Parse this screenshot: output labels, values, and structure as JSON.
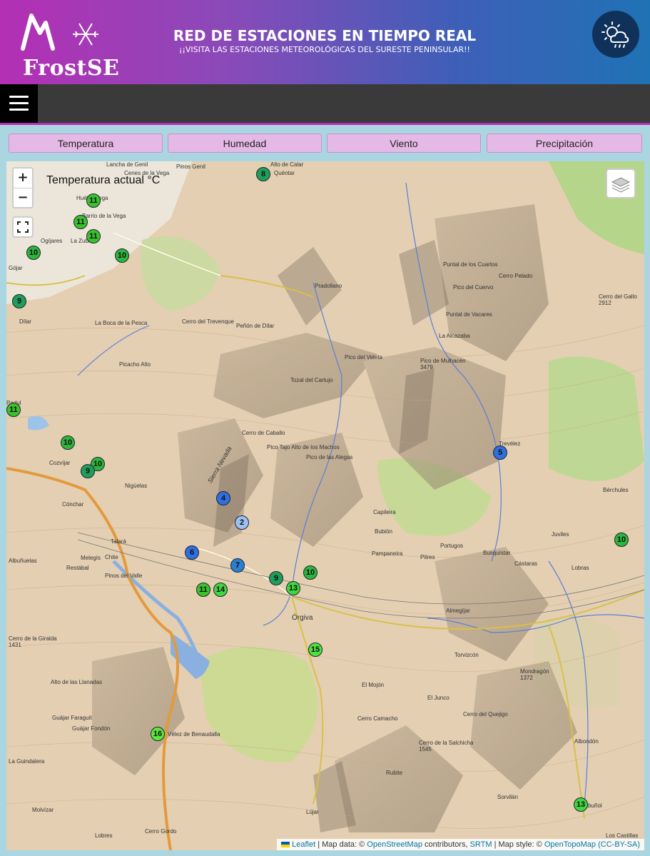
{
  "header": {
    "logo_text": "FrostSE",
    "title": "RED DE ESTACIONES EN TIEMPO REAL",
    "subtitle": "¡¡VISITA LAS ESTACIONES METEOROLÓGICAS DEL SURESTE PENINSULAR!!",
    "weather_icon": "weather-icon"
  },
  "tabs": [
    {
      "label": "Temperatura"
    },
    {
      "label": "Humedad"
    },
    {
      "label": "Viento"
    },
    {
      "label": "Precipitación"
    }
  ],
  "map": {
    "layer_label": "Temperatura actual °C",
    "zoom_in": "+",
    "zoom_out": "−",
    "attribution": {
      "leaflet": "Leaflet",
      "sep1": " | Map data: © ",
      "osm": "OpenStreetMap",
      "contrib": " contributors, ",
      "srtm": "SRTM",
      "style": " | Map style: © ",
      "otm": "OpenTopoMap",
      "license": "(CC-BY-SA)"
    },
    "markers": [
      {
        "value": "8",
        "color": "#1f9e5a"
      },
      {
        "value": "11",
        "color": "#39c22c"
      },
      {
        "value": "11",
        "color": "#39c22c"
      },
      {
        "value": "11",
        "color": "#39c22c"
      },
      {
        "value": "10",
        "color": "#2db53c"
      },
      {
        "value": "10",
        "color": "#2db53c"
      },
      {
        "value": "9",
        "color": "#1f9e5a"
      },
      {
        "value": "11",
        "color": "#39c22c"
      },
      {
        "value": "10",
        "color": "#2db53c"
      },
      {
        "value": "10",
        "color": "#2db53c"
      },
      {
        "value": "9",
        "color": "#1f9e5a"
      },
      {
        "value": "5",
        "color": "#2f6fe0"
      },
      {
        "value": "4",
        "color": "#2f6fe0"
      },
      {
        "value": "2",
        "color": "#9dc0f0"
      },
      {
        "value": "6",
        "color": "#2f6fe0"
      },
      {
        "value": "7",
        "color": "#2a7fd0"
      },
      {
        "value": "9",
        "color": "#1f9e5a"
      },
      {
        "value": "10",
        "color": "#2db53c"
      },
      {
        "value": "13",
        "color": "#3fd63f"
      },
      {
        "value": "11",
        "color": "#39c22c"
      },
      {
        "value": "14",
        "color": "#3fd63f"
      },
      {
        "value": "10",
        "color": "#2db53c"
      },
      {
        "value": "15",
        "color": "#4fe040"
      },
      {
        "value": "16",
        "color": "#5ae83c"
      },
      {
        "value": "13",
        "color": "#3fd63f"
      }
    ],
    "places": [
      "Pinos Genil",
      "Huétor Vega",
      "Barrio de la Vega",
      "Ogíjares",
      "La Zubia",
      "Gójar",
      "Dílar",
      "Pradollano",
      "Peñón de Dílar",
      "Cerro del Trevenque",
      "La Boca de la Pesca",
      "Picacho Alto",
      "Pico del Veleta",
      "Pico de Mulhacén 3479",
      "Tozal del Cartujo",
      "Cerro de Caballo",
      "Pico Tajo Alto de los Machos",
      "Pico de las Alegas",
      "Trevélez",
      "Capileira",
      "Bubión",
      "Pampaneira",
      "Pitres",
      "Portugos",
      "Busquístar",
      "Cástaras",
      "Lobras",
      "Bérchules",
      "Juviles",
      "Órgiva",
      "Almegíjar",
      "Torvizcón",
      "El Mojón",
      "El Junco",
      "Cerro del Quejigo",
      "Cerro de la Salchicha 1545",
      "Cerro Camacho",
      "Mondragón 1372",
      "Albondón",
      "Rubite",
      "Sorvilán",
      "Albuñol",
      "Los Castillas",
      "Lújar",
      "Cerro Gordo",
      "Lobres",
      "Molvízar",
      "Vélez de Benaudalla",
      "Guájar Faraguit",
      "Guájar Fondón",
      "Alto de las Llanadas",
      "Pinos del Valle",
      "Restábal",
      "Melegís",
      "Chite",
      "Talará",
      "Nigüelas",
      "Cónchar",
      "Cozvíjar",
      "Padul",
      "Albuñuelas",
      "Cerro de la Giralda 1431",
      "La Guindalera",
      "Puntal de los Cuartos",
      "Cerro Pelado",
      "Pico del Cuervo",
      "Puntal de Vacares",
      "La Alcazaba",
      "Cerro del Gallo 2912",
      "Alto de Calar",
      "Quéntar",
      "Cenes de la Vega",
      "Lancha de Genil",
      "Lújar",
      "Sierra Nevada"
    ]
  }
}
